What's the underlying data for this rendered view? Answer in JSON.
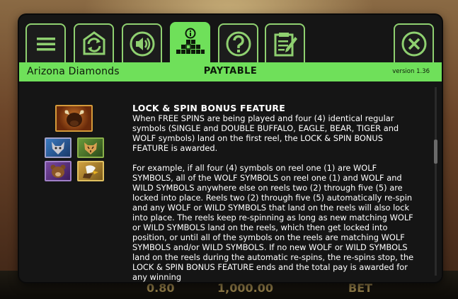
{
  "header": {
    "game_name": "Arizona Diamonds",
    "section_title": "PAYTABLE",
    "version": "version 1.36"
  },
  "tabs": [
    {
      "icon": "menu-icon"
    },
    {
      "icon": "autoplay-icon"
    },
    {
      "icon": "sound-icon"
    },
    {
      "icon": "paytable-icon",
      "active": true
    },
    {
      "icon": "help-icon"
    },
    {
      "icon": "history-icon"
    },
    {
      "icon": "close-icon"
    }
  ],
  "background": {
    "bet_value": "0.80",
    "win_value": "1,000.00",
    "bet_label": "BET"
  },
  "content": {
    "heading": "LOCK & SPIN BONUS FEATURE",
    "paragraph1": "When FREE SPINS are being played and four (4) identical regular symbols (SINGLE and DOUBLE BUFFALO, EAGLE, BEAR, TIGER and WOLF symbols) land on the first reel, the LOCK & SPIN BONUS FEATURE is awarded.",
    "paragraph2": "For example, if all four (4) symbols on reel one (1) are WOLF SYMBOLS, all of the WOLF SYMBOLS on reel one (1) and WOLF and WILD SYMBOLS anywhere else on reels two (2) through five (5) are locked into place. Reels two (2) through five (5) automatically re-spin and any WOLF or WILD SYMBOLS that land on the reels will also lock into place. The reels keep re-spinning as long as new matching WOLF or WILD SYMBOLS land on the reels, which then get locked into position, or until all of the symbols on the reels are matching WOLF SYMBOLS and/or WILD SYMBOLS. If no new WOLF or WILD SYMBOLS land on the reels during the automatic re-spins, the re-spins stop, the LOCK & SPIN BONUS FEATURE ends and the total pay is awarded for any winning"
  },
  "symbols": [
    {
      "name": "buffalo",
      "color": "#7a3a12"
    },
    {
      "name": "wolf",
      "color": "#2b5a8a"
    },
    {
      "name": "tiger",
      "color": "#5a8a2a"
    },
    {
      "name": "bear",
      "color": "#6a3a8a"
    },
    {
      "name": "eagle",
      "color": "#b08a2a"
    }
  ],
  "colors": {
    "accent": "#6fe05a",
    "panel": "#151515"
  }
}
